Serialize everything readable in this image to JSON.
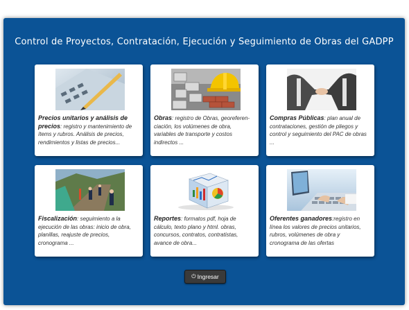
{
  "page": {
    "title": "Control de Proyectos, Contratación, Ejecución y Seguimiento de Obras del GADPP"
  },
  "modules": [
    {
      "title": "Precios unitarios y análisis de precios",
      "desc": ": registro y mantenimiento de ítems y rubros. Análisis de precios, rendimientos y listas de precios...",
      "icon": "calculator-pencil-image"
    },
    {
      "title": "Obras",
      "desc": ": registro de Obras, georeferen-ciación, los volúmenes de obra, variables de transporte y costos indirectos ...",
      "icon": "construction-helmet-image"
    },
    {
      "title": "Compras Públicas",
      "desc": ": plan anual de contrataciones, gestión de pliegos y control y seguimiento del PAC de obras ...",
      "icon": "handshake-image"
    },
    {
      "title": "Fiscalización",
      "desc": ": seguimiento a la ejecución de las obras: inicio de obra, planillas, reajuste de precios, cronograma ...",
      "icon": "road-workers-image"
    },
    {
      "title": "Reportes",
      "desc": ": formatos pdf, hoja de cálculo, texto plano y html. obras, concursos, contratos, contratistas, avance de obra...",
      "icon": "report-cube-image"
    },
    {
      "title": "Oferentes ganadores",
      "desc": ":registro en línea los valores de precios unitarios, rubros, volúmenes de obra y cronograma de las ofertas",
      "icon": "keyboard-typing-image"
    }
  ],
  "button": {
    "label": "Ingresar",
    "icon": "power-icon"
  },
  "colors": {
    "panel": "#0b5396",
    "card": "#ffffff",
    "button": "#3a3a3a"
  }
}
